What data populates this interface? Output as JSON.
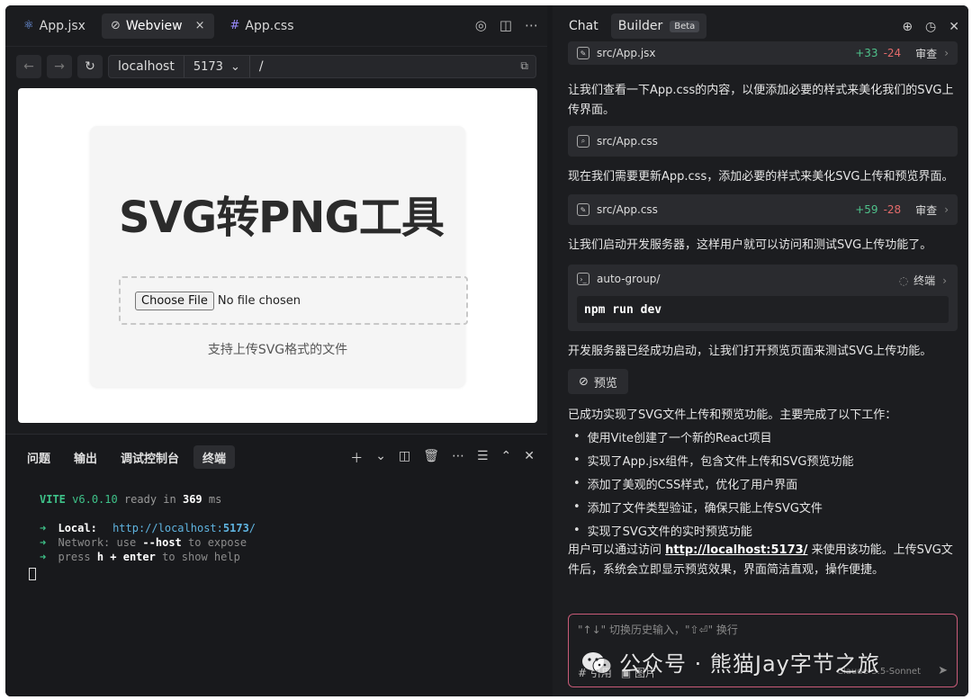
{
  "editor": {
    "tabs": [
      {
        "label": "App.jsx",
        "icon": "react-icon"
      },
      {
        "label": "Webview",
        "icon": "link-icon",
        "close": "×"
      },
      {
        "label": "App.css",
        "icon": "hash-icon"
      }
    ]
  },
  "address": {
    "host": "localhost",
    "port": "5173",
    "path": "/"
  },
  "webview": {
    "title": "SVG转PNG工具",
    "file_button": "Choose File",
    "file_status": "No file chosen",
    "hint": "支持上传SVG格式的文件"
  },
  "panel": {
    "tabs": [
      "问题",
      "输出",
      "调试控制台",
      "终端"
    ],
    "terminal": {
      "vite": "VITE",
      "version": "v6.0.10",
      "ready": "ready in",
      "ms_value": "369",
      "ms_unit": "ms",
      "arrow": "➜",
      "local_label": "Local:",
      "local_url_prefix": "http://localhost:",
      "local_url_port": "5173",
      "local_url_suffix": "/",
      "network_label": "Network:",
      "network_use": "use",
      "network_flag": "--host",
      "network_rest": "to expose",
      "press": "press",
      "press_keys": "h + enter",
      "press_rest": "to show help"
    }
  },
  "sidebar": {
    "tabs": {
      "chat": "Chat",
      "builder": "Builder",
      "beta": "Beta"
    },
    "file1": {
      "name": "src/App.jsx",
      "plus": "+33",
      "minus": "-24",
      "review": "审查"
    },
    "msg1": "让我们查看一下App.css的内容，以便添加必要的样式来美化我们的SVG上传界面。",
    "file2": {
      "name": "src/App.css"
    },
    "msg2": "现在我们需要更新App.css，添加必要的样式来美化SVG上传和预览界面。",
    "file3": {
      "name": "src/App.css",
      "plus": "+59",
      "minus": "-28",
      "review": "审查"
    },
    "msg3": "让我们启动开发服务器，这样用户就可以访问和测试SVG上传功能了。",
    "cmd": {
      "dir": "auto-group/",
      "label": "终端",
      "command": "npm run dev"
    },
    "msg4": "开发服务器已经成功启动，让我们打开预览页面来测试SVG上传功能。",
    "preview": "预览",
    "msg5": "已成功实现了SVG文件上传和预览功能。主要完成了以下工作：",
    "bullets": [
      "使用Vite创建了一个新的React项目",
      "实现了App.jsx组件，包含文件上传和SVG预览功能",
      "添加了美观的CSS样式，优化了用户界面",
      "添加了文件类型验证，确保只能上传SVG文件",
      "实现了SVG文件的实时预览功能"
    ],
    "msg6_pre": "用户可以通过访问",
    "msg6_link": "http://localhost:5173/",
    "msg6_post": "来使用该功能。上传SVG文件后，系统会立即显示预览效果，界面简洁直观，操作便捷。",
    "input": {
      "placeholder": "\"↑↓\" 切换历史输入，\"⇧⏎\" 换行",
      "ref": "# 引用",
      "image": "图片",
      "model": "Claude-3.5-Sonnet"
    }
  },
  "watermark": "公众号 · 熊猫Jay字节之旅"
}
